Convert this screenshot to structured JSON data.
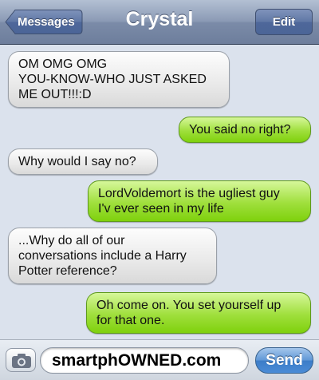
{
  "header": {
    "back_label": "Messages",
    "title": "Crystal",
    "edit_label": "Edit"
  },
  "messages": [
    {
      "from": "them",
      "line1": "OM OMG OMG",
      "line2": "YOU-KNOW-WHO JUST ASKED",
      "line3": "ME OUT!!!:D"
    },
    {
      "from": "me",
      "line1": "You said no right?"
    },
    {
      "from": "them",
      "line1": "Why would I say no?"
    },
    {
      "from": "me",
      "line1": "LordVoldemort is the ugliest guy",
      "line2": "I'v ever seen in my life"
    },
    {
      "from": "them",
      "line1": "...Why do all of our",
      "line2": "conversations include a Harry",
      "line3": "Potter reference?"
    },
    {
      "from": "me",
      "line1": "Oh come on. You set yourself up",
      "line2": "for that one."
    }
  ],
  "composer": {
    "text_value": "smartphOWNED.com",
    "send_label": "Send",
    "camera_icon": "camera-icon"
  },
  "colors": {
    "sent_bubble": "#9fdf3c",
    "received_bubble": "#e9e9e9",
    "background": "#dbe2ed",
    "send_button": "#4a8bd6"
  }
}
